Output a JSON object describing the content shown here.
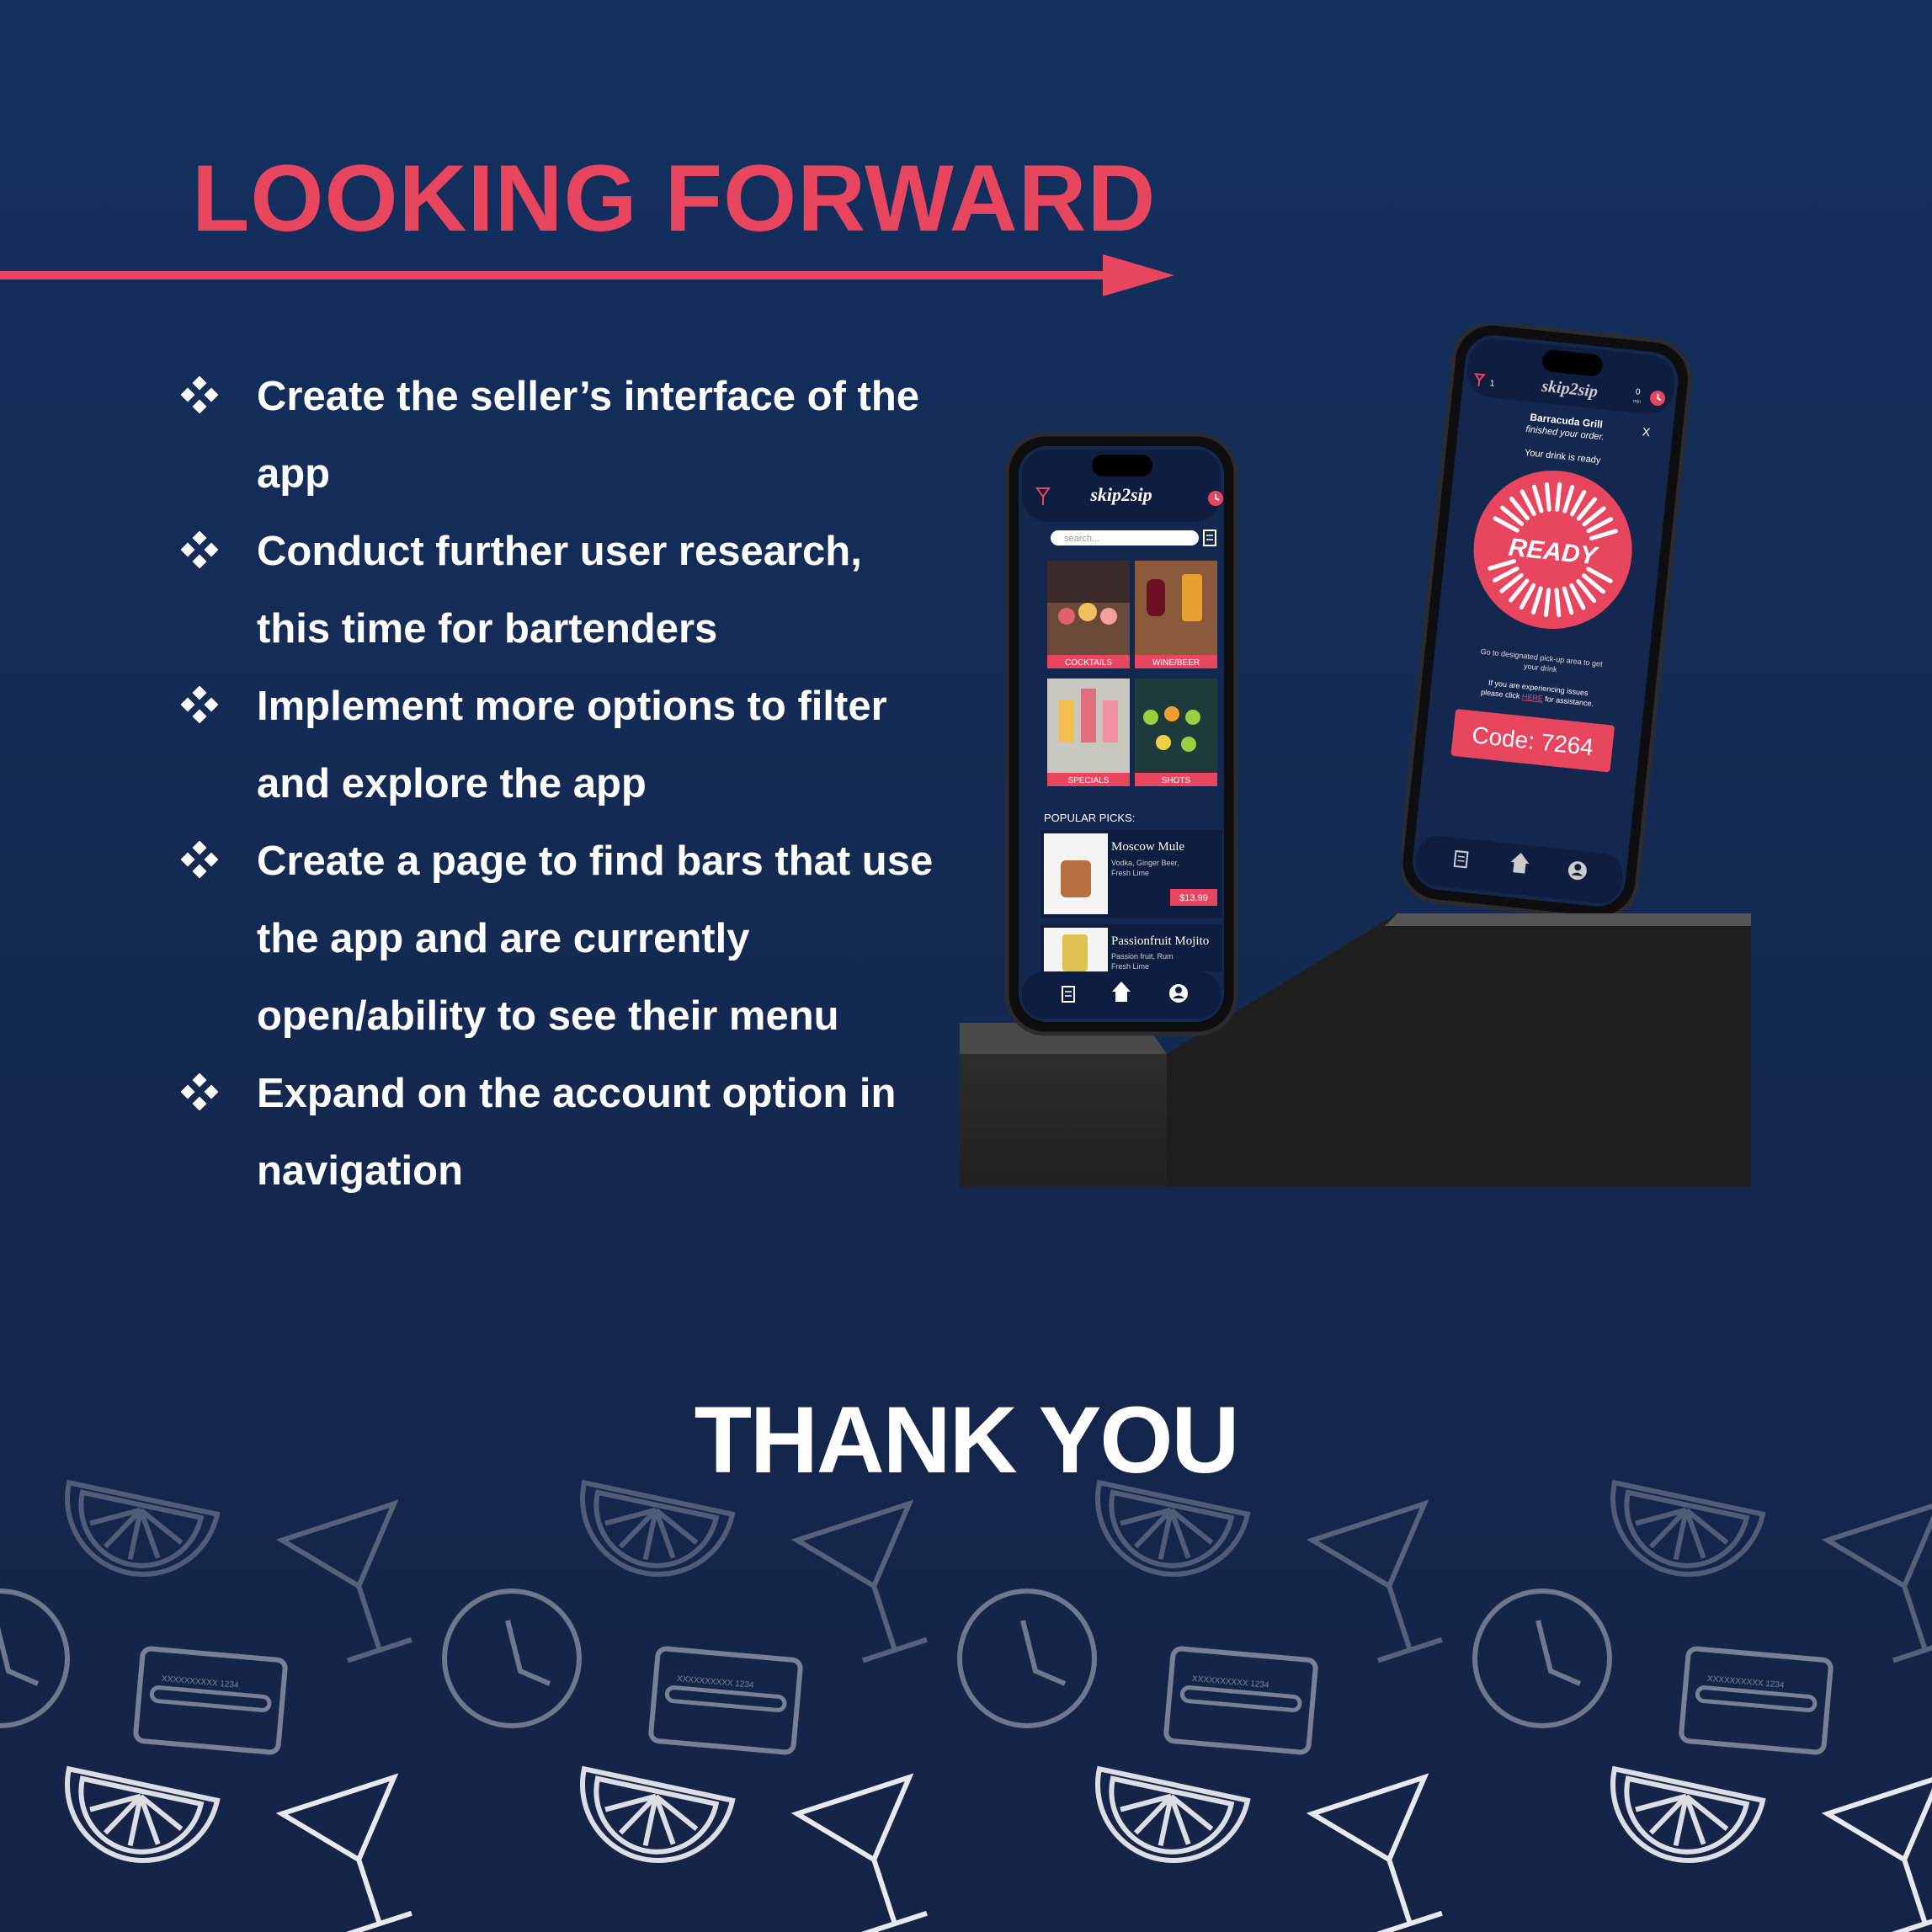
{
  "heading": "LOOKING FORWARD",
  "bullets": [
    "Create the seller’s interface of the app",
    "Conduct further user research, this time for bartenders",
    "Implement more options to filter and explore the app",
    "Create a page to find bars that use the app and are currently open/ability to see their menu",
    "Expand on the account option in navigation"
  ],
  "closing": "THANK YOU",
  "colors": {
    "accent": "#e8455f",
    "background": "#13305f",
    "text": "#ffffff"
  },
  "phone_left": {
    "logo": "skip2sip",
    "search_placeholder": "search...",
    "categories": [
      "COCKTAILS",
      "WINE/BEER",
      "SPECIALS",
      "SHOTS"
    ],
    "popular_heading": "POPULAR PICKS:",
    "items": [
      {
        "name": "Moscow Mule",
        "desc1": "Vodka, Ginger Beer,",
        "desc2": "Fresh Lime",
        "price": "$13.99"
      },
      {
        "name": "Passionfruit Mojito",
        "desc1": "Passion fruit, Rum",
        "desc2": "Fresh Lime"
      }
    ]
  },
  "phone_right": {
    "logo": "skip2sip",
    "cart_count": "1",
    "timer_value": "0",
    "timer_unit": "min",
    "bar_name": "Barracuda Grill",
    "finished": "finished your order.",
    "ready_line": "Your drink is ready",
    "close": "X",
    "ready_label": "READY",
    "pickup_line1": "Go to designated pick-up area to get",
    "pickup_line2": "your drink",
    "issues_line1": "If you are experiencing issues",
    "issues_pre": "please click ",
    "issues_link": "HERE",
    "issues_post": " for assistance.",
    "code": "Code: 7264"
  },
  "card_number": "XXXXXXXXXX 1234"
}
